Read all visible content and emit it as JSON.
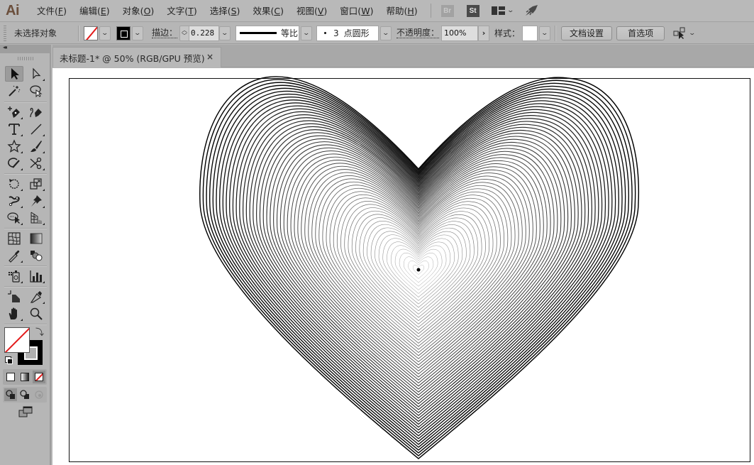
{
  "app": {
    "logo": "Ai",
    "menu": [
      {
        "label": "文件",
        "key": "F"
      },
      {
        "label": "编辑",
        "key": "E"
      },
      {
        "label": "对象",
        "key": "O"
      },
      {
        "label": "文字",
        "key": "T"
      },
      {
        "label": "选择",
        "key": "S"
      },
      {
        "label": "效果",
        "key": "C"
      },
      {
        "label": "视图",
        "key": "V"
      },
      {
        "label": "窗口",
        "key": "W"
      },
      {
        "label": "帮助",
        "key": "H"
      }
    ],
    "bridge_label": "Br",
    "stock_label": "St"
  },
  "control_bar": {
    "selection_status": "未选择对象",
    "fill": "none",
    "stroke_label": "描边：",
    "stroke_weight": "0.228 pt",
    "profile_label": "等比",
    "brush_size": "3",
    "brush_label": "点圆形",
    "opacity_label": "不透明度：",
    "opacity_value": "100%",
    "style_label": "样式：",
    "doc_setup_button": "文档设置",
    "preferences_button": "首选项"
  },
  "document": {
    "tab_title": "未标题-1* @ 50% (RGB/GPU 预览)",
    "close_glyph": "×",
    "zoom": "50%",
    "color_mode": "RGB/GPU 预览"
  },
  "tools": {
    "active": "selection-tool",
    "colors": {
      "fill": "none",
      "stroke": "#000000",
      "none_slash": "#e31a1a"
    }
  },
  "artwork": {
    "description": "heart formed by nested concentric line curves converging to a focal point",
    "curve_count": 60,
    "stroke_color": "#000000"
  }
}
